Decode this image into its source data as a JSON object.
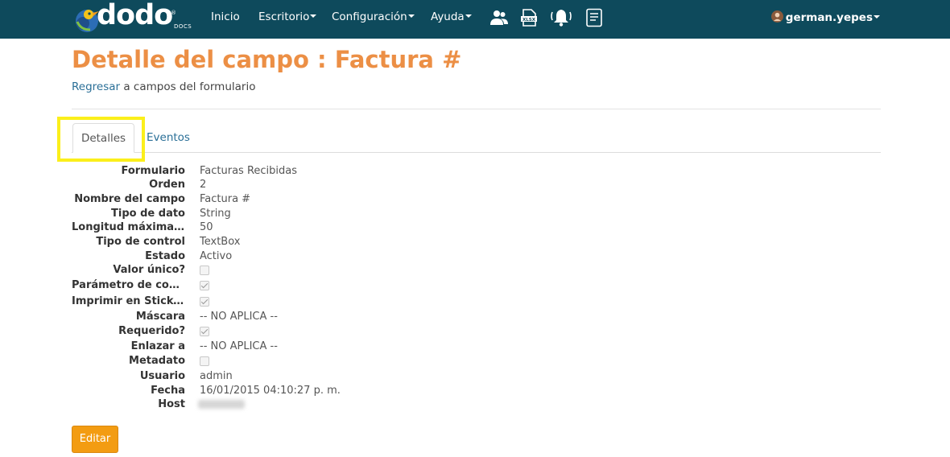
{
  "brand": {
    "name": "dodo",
    "sub": "DOCS",
    "reg": "®"
  },
  "nav": {
    "items": [
      {
        "label": "Inicio",
        "dropdown": false
      },
      {
        "label": "Escritorio",
        "dropdown": true
      },
      {
        "label": "Configuración",
        "dropdown": true
      },
      {
        "label": "Ayuda",
        "dropdown": true
      }
    ],
    "icons": [
      "users-icon",
      "xlsx-file-icon",
      "bell-icon",
      "document-list-icon"
    ],
    "user": "german.yepes"
  },
  "page": {
    "title": "Detalle del campo : Factura #",
    "back_link": "Regresar",
    "back_text": " a campos del formulario"
  },
  "tabs": {
    "active": "Detalles",
    "other": "Eventos"
  },
  "details": {
    "formulario": {
      "label": "Formulario",
      "value": "Facturas Recibidas"
    },
    "orden": {
      "label": "Orden",
      "value": "2"
    },
    "nombre": {
      "label": "Nombre del campo",
      "value": "Factura #"
    },
    "tipo_dato": {
      "label": "Tipo de dato",
      "value": "String"
    },
    "longitud": {
      "label": "Longitud máxima de…",
      "value": "50"
    },
    "tipo_control": {
      "label": "Tipo de control",
      "value": "TextBox"
    },
    "estado": {
      "label": "Estado",
      "value": "Activo"
    },
    "valor_unico": {
      "label": "Valor único?",
      "checked": false
    },
    "parametro": {
      "label": "Parámetro de consu…",
      "checked": true
    },
    "imprimir": {
      "label": "Imprimir en Sticker?",
      "checked": true
    },
    "mascara": {
      "label": "Máscara",
      "value": "-- NO APLICA --"
    },
    "requerido": {
      "label": "Requerido?",
      "checked": true
    },
    "enlazar": {
      "label": "Enlazar a",
      "value": "-- NO APLICA --"
    },
    "metadato": {
      "label": "Metadato",
      "checked": false
    },
    "usuario": {
      "label": "Usuario",
      "value": "admin"
    },
    "fecha": {
      "label": "Fecha",
      "value": "16/01/2015 04:10:27 p. m."
    },
    "host": {
      "label": "Host"
    }
  },
  "actions": {
    "edit": "Editar"
  },
  "colors": {
    "navbar": "#0e4a5c",
    "title": "#ec8f45",
    "link": "#2a6f97",
    "button": "#f39c12",
    "highlight": "#fbef1b"
  }
}
